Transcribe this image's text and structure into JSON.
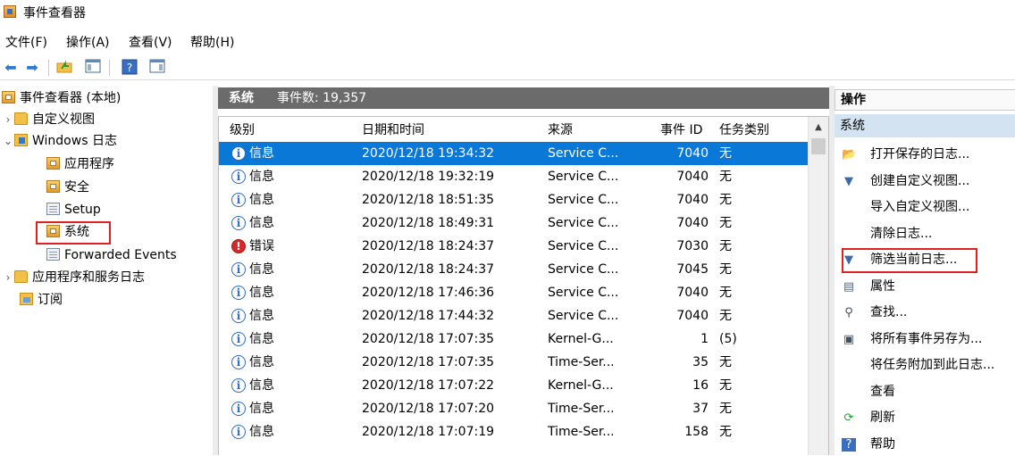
{
  "window": {
    "title": "事件查看器"
  },
  "menu": [
    "文件(F)",
    "操作(A)",
    "查看(V)",
    "帮助(H)"
  ],
  "toolbar": {
    "buttons": [
      "back-icon",
      "forward-icon",
      "folder-up-icon",
      "show-hide-tree-icon",
      "help-icon",
      "show-action-pane-icon"
    ]
  },
  "tree": {
    "root": "事件查看器 (本地)",
    "custom_views": "自定义视图",
    "windows_logs": "Windows 日志",
    "application": "应用程序",
    "security": "安全",
    "setup": "Setup",
    "system": "系统",
    "forwarded": "Forwarded Events",
    "app_service_logs": "应用程序和服务日志",
    "subscriptions": "订阅"
  },
  "middle": {
    "log_name": "系统",
    "event_count": "事件数: 19,357",
    "columns": {
      "level": "级别",
      "datetime": "日期和时间",
      "source": "来源",
      "event_id": "事件 ID",
      "task": "任务类别"
    },
    "rows": [
      {
        "level": "信息",
        "type": "info",
        "datetime": "2020/12/18 19:34:32",
        "source": "Service C...",
        "id": "7040",
        "task": "无",
        "selected": true
      },
      {
        "level": "信息",
        "type": "info",
        "datetime": "2020/12/18 19:32:19",
        "source": "Service C...",
        "id": "7040",
        "task": "无"
      },
      {
        "level": "信息",
        "type": "info",
        "datetime": "2020/12/18 18:51:35",
        "source": "Service C...",
        "id": "7040",
        "task": "无"
      },
      {
        "level": "信息",
        "type": "info",
        "datetime": "2020/12/18 18:49:31",
        "source": "Service C...",
        "id": "7040",
        "task": "无"
      },
      {
        "level": "错误",
        "type": "error",
        "datetime": "2020/12/18 18:24:37",
        "source": "Service C...",
        "id": "7030",
        "task": "无"
      },
      {
        "level": "信息",
        "type": "info",
        "datetime": "2020/12/18 18:24:37",
        "source": "Service C...",
        "id": "7045",
        "task": "无"
      },
      {
        "level": "信息",
        "type": "info",
        "datetime": "2020/12/18 17:46:36",
        "source": "Service C...",
        "id": "7040",
        "task": "无"
      },
      {
        "level": "信息",
        "type": "info",
        "datetime": "2020/12/18 17:44:32",
        "source": "Service C...",
        "id": "7040",
        "task": "无"
      },
      {
        "level": "信息",
        "type": "info",
        "datetime": "2020/12/18 17:07:35",
        "source": "Kernel-G...",
        "id": "1",
        "task": "(5)"
      },
      {
        "level": "信息",
        "type": "info",
        "datetime": "2020/12/18 17:07:35",
        "source": "Time-Ser...",
        "id": "35",
        "task": "无"
      },
      {
        "level": "信息",
        "type": "info",
        "datetime": "2020/12/18 17:07:22",
        "source": "Kernel-G...",
        "id": "16",
        "task": "无"
      },
      {
        "level": "信息",
        "type": "info",
        "datetime": "2020/12/18 17:07:20",
        "source": "Time-Ser...",
        "id": "37",
        "task": "无"
      },
      {
        "level": "信息",
        "type": "info",
        "datetime": "2020/12/18 17:07:19",
        "source": "Time-Ser...",
        "id": "158",
        "task": "无"
      }
    ]
  },
  "actions": {
    "header": "操作",
    "section": "系统",
    "items": [
      {
        "label": "打开保存的日志...",
        "icon": "open-folder-icon"
      },
      {
        "label": "创建自定义视图...",
        "icon": "filter-icon"
      },
      {
        "label": "导入自定义视图...",
        "icon": ""
      },
      {
        "label": "清除日志...",
        "icon": ""
      },
      {
        "label": "筛选当前日志...",
        "icon": "filter-icon"
      },
      {
        "label": "属性",
        "icon": "properties-icon"
      },
      {
        "label": "查找...",
        "icon": "binoculars-icon"
      },
      {
        "label": "将所有事件另存为...",
        "icon": "save-icon"
      },
      {
        "label": "将任务附加到此日志...",
        "icon": ""
      },
      {
        "label": "查看",
        "icon": ""
      },
      {
        "label": "刷新",
        "icon": "refresh-icon"
      },
      {
        "label": "帮助",
        "icon": "help-icon"
      }
    ]
  },
  "colors": {
    "selection": "#0a78d7",
    "highlight_box": "#e02020",
    "header_gray": "#6b6b6b",
    "action_section": "#d4e3f2"
  }
}
